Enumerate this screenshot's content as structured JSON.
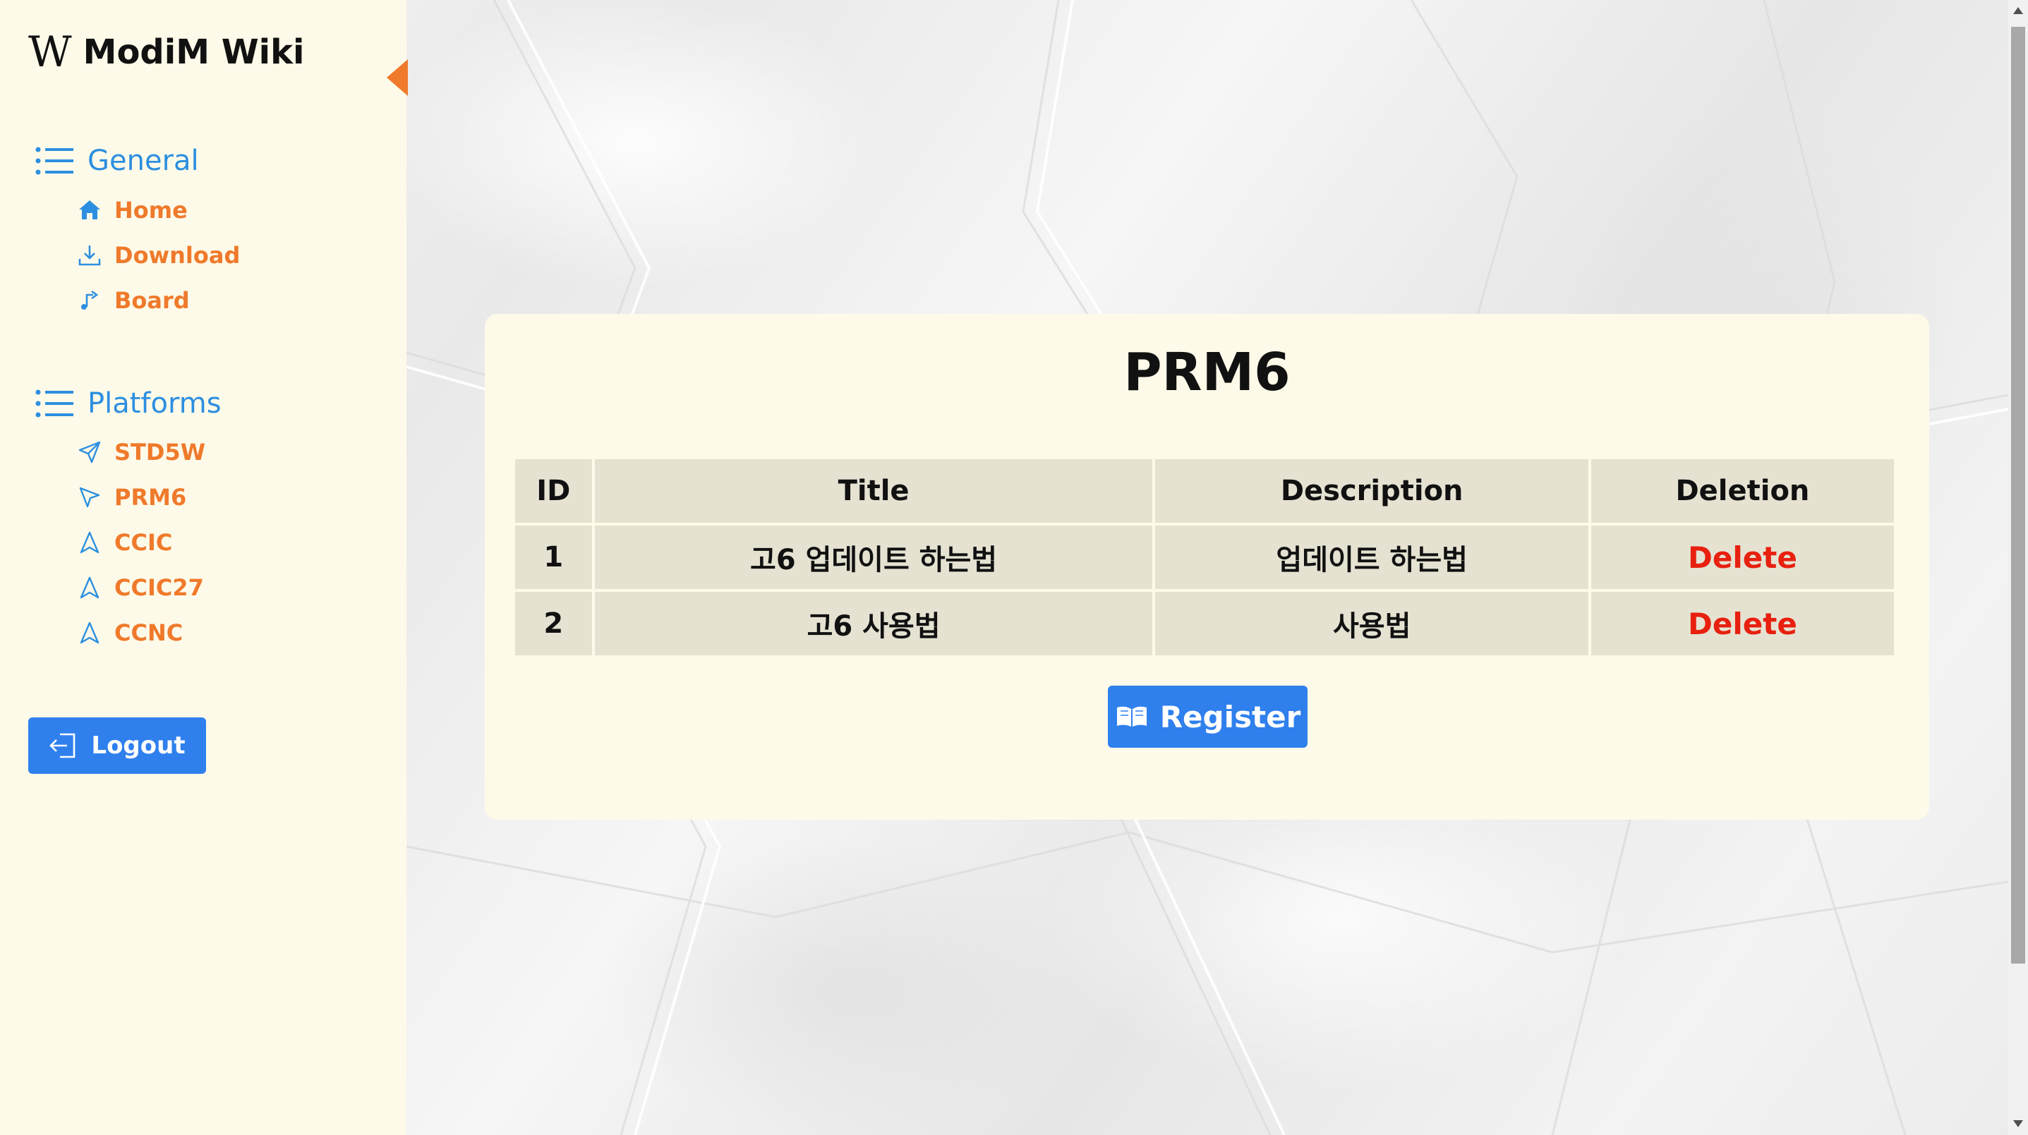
{
  "sidebar": {
    "brand_logo": "W",
    "brand_title": "ModiM Wiki",
    "general": {
      "label": "General",
      "items": [
        {
          "label": "Home",
          "icon": "home-icon"
        },
        {
          "label": "Download",
          "icon": "download-icon"
        },
        {
          "label": "Board",
          "icon": "board-icon"
        }
      ]
    },
    "platforms": {
      "label": "Platforms",
      "items": [
        {
          "label": "STD5W",
          "icon": "send-icon"
        },
        {
          "label": "PRM6",
          "icon": "cursor-icon"
        },
        {
          "label": "CCIC",
          "icon": "navigation-icon"
        },
        {
          "label": "CCIC27",
          "icon": "navigation-icon"
        },
        {
          "label": "CCNC",
          "icon": "navigation-icon"
        }
      ]
    },
    "logout_label": "Logout"
  },
  "main": {
    "title": "PRM6",
    "table": {
      "headers": [
        "ID",
        "Title",
        "Description",
        "Deletion"
      ],
      "rows": [
        {
          "id": "1",
          "title": "고6 업데이트 하는법",
          "description": "업데이트 하는법",
          "action": "Delete"
        },
        {
          "id": "2",
          "title": "고6 사용법",
          "description": "사용법",
          "action": "Delete"
        }
      ]
    },
    "register_label": "Register"
  },
  "colors": {
    "sidebar_bg": "#fefae9",
    "accent_orange": "#ef7a2b",
    "section_blue": "#2c8fe0",
    "button_blue": "#2f80ed",
    "delete_red": "#e8200f",
    "cell_bg": "#e5e2d2"
  }
}
